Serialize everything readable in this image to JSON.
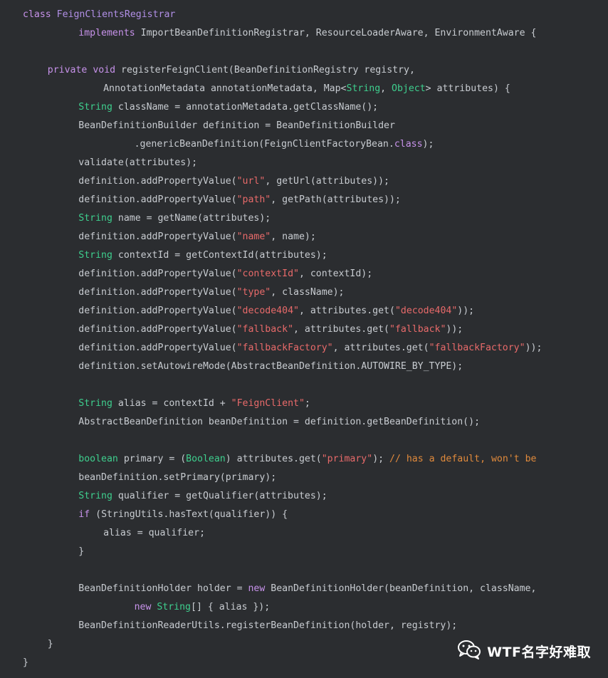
{
  "code_lines": [
    {
      "indent": 2,
      "tokens": [
        {
          "t": "class ",
          "c": "kw"
        },
        {
          "t": "FeignClientsRegistrar",
          "c": "cls"
        }
      ]
    },
    {
      "indent": 11,
      "tokens": [
        {
          "t": "implements ",
          "c": "kw"
        },
        {
          "t": "ImportBeanDefinitionRegistrar, ResourceLoaderAware, EnvironmentAware {",
          "c": "pl"
        }
      ]
    },
    {
      "indent": 0,
      "tokens": []
    },
    {
      "indent": 6,
      "tokens": [
        {
          "t": "private ",
          "c": "kw"
        },
        {
          "t": "void ",
          "c": "kw"
        },
        {
          "t": "registerFeignClient(BeanDefinitionRegistry registry,",
          "c": "pl"
        }
      ]
    },
    {
      "indent": 15,
      "tokens": [
        {
          "t": "AnnotationMetadata annotationMetadata, Map<",
          "c": "pl"
        },
        {
          "t": "String",
          "c": "type"
        },
        {
          "t": ", ",
          "c": "pl"
        },
        {
          "t": "Object",
          "c": "type"
        },
        {
          "t": "> attributes) {",
          "c": "pl"
        }
      ]
    },
    {
      "indent": 11,
      "tokens": [
        {
          "t": "String ",
          "c": "type"
        },
        {
          "t": "className = annotationMetadata.getClassName();",
          "c": "pl"
        }
      ]
    },
    {
      "indent": 11,
      "tokens": [
        {
          "t": "BeanDefinitionBuilder definition = BeanDefinitionBuilder",
          "c": "pl"
        }
      ]
    },
    {
      "indent": 20,
      "tokens": [
        {
          "t": ".genericBeanDefinition(FeignClientFactoryBean.",
          "c": "pl"
        },
        {
          "t": "class",
          "c": "kw"
        },
        {
          "t": ");",
          "c": "pl"
        }
      ]
    },
    {
      "indent": 11,
      "tokens": [
        {
          "t": "validate(attributes);",
          "c": "pl"
        }
      ]
    },
    {
      "indent": 11,
      "tokens": [
        {
          "t": "definition.addPropertyValue(",
          "c": "pl"
        },
        {
          "t": "\"url\"",
          "c": "str"
        },
        {
          "t": ", getUrl(attributes));",
          "c": "pl"
        }
      ]
    },
    {
      "indent": 11,
      "tokens": [
        {
          "t": "definition.addPropertyValue(",
          "c": "pl"
        },
        {
          "t": "\"path\"",
          "c": "str"
        },
        {
          "t": ", getPath(attributes));",
          "c": "pl"
        }
      ]
    },
    {
      "indent": 11,
      "tokens": [
        {
          "t": "String ",
          "c": "type"
        },
        {
          "t": "name = getName(attributes);",
          "c": "pl"
        }
      ]
    },
    {
      "indent": 11,
      "tokens": [
        {
          "t": "definition.addPropertyValue(",
          "c": "pl"
        },
        {
          "t": "\"name\"",
          "c": "str"
        },
        {
          "t": ", name);",
          "c": "pl"
        }
      ]
    },
    {
      "indent": 11,
      "tokens": [
        {
          "t": "String ",
          "c": "type"
        },
        {
          "t": "contextId = getContextId(attributes);",
          "c": "pl"
        }
      ]
    },
    {
      "indent": 11,
      "tokens": [
        {
          "t": "definition.addPropertyValue(",
          "c": "pl"
        },
        {
          "t": "\"contextId\"",
          "c": "str"
        },
        {
          "t": ", contextId);",
          "c": "pl"
        }
      ]
    },
    {
      "indent": 11,
      "tokens": [
        {
          "t": "definition.addPropertyValue(",
          "c": "pl"
        },
        {
          "t": "\"type\"",
          "c": "str"
        },
        {
          "t": ", className);",
          "c": "pl"
        }
      ]
    },
    {
      "indent": 11,
      "tokens": [
        {
          "t": "definition.addPropertyValue(",
          "c": "pl"
        },
        {
          "t": "\"decode404\"",
          "c": "str"
        },
        {
          "t": ", attributes.get(",
          "c": "pl"
        },
        {
          "t": "\"decode404\"",
          "c": "str"
        },
        {
          "t": "));",
          "c": "pl"
        }
      ]
    },
    {
      "indent": 11,
      "tokens": [
        {
          "t": "definition.addPropertyValue(",
          "c": "pl"
        },
        {
          "t": "\"fallback\"",
          "c": "str"
        },
        {
          "t": ", attributes.get(",
          "c": "pl"
        },
        {
          "t": "\"fallback\"",
          "c": "str"
        },
        {
          "t": "));",
          "c": "pl"
        }
      ]
    },
    {
      "indent": 11,
      "tokens": [
        {
          "t": "definition.addPropertyValue(",
          "c": "pl"
        },
        {
          "t": "\"fallbackFactory\"",
          "c": "str"
        },
        {
          "t": ", attributes.get(",
          "c": "pl"
        },
        {
          "t": "\"fallbackFactory\"",
          "c": "str"
        },
        {
          "t": "));",
          "c": "pl"
        }
      ]
    },
    {
      "indent": 11,
      "tokens": [
        {
          "t": "definition.setAutowireMode(AbstractBeanDefinition.AUTOWIRE_BY_TYPE);",
          "c": "pl"
        }
      ]
    },
    {
      "indent": 0,
      "tokens": []
    },
    {
      "indent": 11,
      "tokens": [
        {
          "t": "String ",
          "c": "type"
        },
        {
          "t": "alias = contextId + ",
          "c": "pl"
        },
        {
          "t": "\"FeignClient\"",
          "c": "str"
        },
        {
          "t": ";",
          "c": "pl"
        }
      ]
    },
    {
      "indent": 11,
      "tokens": [
        {
          "t": "AbstractBeanDefinition beanDefinition = definition.getBeanDefinition();",
          "c": "pl"
        }
      ]
    },
    {
      "indent": 0,
      "tokens": []
    },
    {
      "indent": 11,
      "tokens": [
        {
          "t": "boolean ",
          "c": "type"
        },
        {
          "t": "primary = (",
          "c": "pl"
        },
        {
          "t": "Boolean",
          "c": "type"
        },
        {
          "t": ") attributes.get(",
          "c": "pl"
        },
        {
          "t": "\"primary\"",
          "c": "str"
        },
        {
          "t": "); ",
          "c": "pl"
        },
        {
          "t": "// has a default, won't be",
          "c": "com"
        }
      ]
    },
    {
      "indent": 11,
      "tokens": [
        {
          "t": "beanDefinition.setPrimary(primary);",
          "c": "pl"
        }
      ]
    },
    {
      "indent": 11,
      "tokens": [
        {
          "t": "String ",
          "c": "type"
        },
        {
          "t": "qualifier = getQualifier(attributes);",
          "c": "pl"
        }
      ]
    },
    {
      "indent": 11,
      "tokens": [
        {
          "t": "if ",
          "c": "kw"
        },
        {
          "t": "(StringUtils.hasText(qualifier)) {",
          "c": "pl"
        }
      ]
    },
    {
      "indent": 15,
      "tokens": [
        {
          "t": "alias = qualifier;",
          "c": "pl"
        }
      ]
    },
    {
      "indent": 11,
      "tokens": [
        {
          "t": "}",
          "c": "pl"
        }
      ]
    },
    {
      "indent": 0,
      "tokens": []
    },
    {
      "indent": 11,
      "tokens": [
        {
          "t": "BeanDefinitionHolder holder = ",
          "c": "pl"
        },
        {
          "t": "new ",
          "c": "kw"
        },
        {
          "t": "BeanDefinitionHolder(beanDefinition, className,",
          "c": "pl"
        }
      ]
    },
    {
      "indent": 20,
      "tokens": [
        {
          "t": "new ",
          "c": "kw"
        },
        {
          "t": "String",
          "c": "type"
        },
        {
          "t": "[] { alias });",
          "c": "pl"
        }
      ]
    },
    {
      "indent": 11,
      "tokens": [
        {
          "t": "BeanDefinitionReaderUtils.registerBeanDefinition(holder, registry);",
          "c": "pl"
        }
      ]
    },
    {
      "indent": 6,
      "tokens": [
        {
          "t": "}",
          "c": "pl"
        }
      ]
    },
    {
      "indent": 2,
      "tokens": [
        {
          "t": "}",
          "c": "pl"
        }
      ]
    }
  ],
  "watermark": {
    "icon": "wechat-icon",
    "text": "WTF名字好难取"
  },
  "colors": {
    "background": "#2b2d30",
    "keyword": "#c792ea",
    "type": "#3ecf8e",
    "string": "#e86a6a",
    "comment": "#e08a3c",
    "plain": "#c8ccd1"
  }
}
